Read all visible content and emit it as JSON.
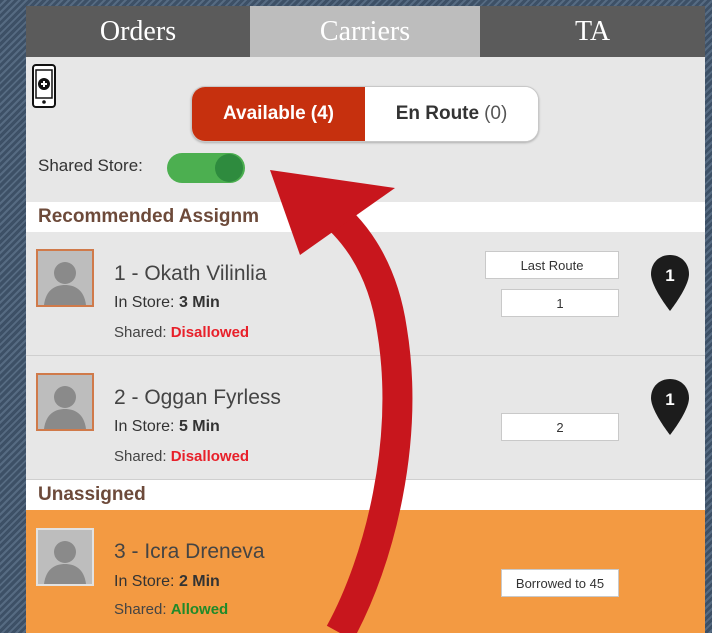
{
  "tabs": [
    {
      "label": "Orders"
    },
    {
      "label": "Carriers"
    },
    {
      "label": "TA"
    }
  ],
  "segment": {
    "available_label": "Available",
    "available_count": "(4)",
    "enroute_label": "En Route",
    "enroute_count": "(0)"
  },
  "shared_store": {
    "label": "Shared Store:",
    "on": true
  },
  "sections": {
    "recommended": "Recommended Assignm",
    "unassigned": "Unassigned"
  },
  "carriers": [
    {
      "name": "1 - Okath Vilinlia",
      "instore_label": "In Store:",
      "instore_value": "3 Min",
      "shared_label": "Shared:",
      "shared_value": "Disallowed",
      "last_route_label": "Last Route",
      "route_value": "1",
      "pin_value": "1"
    },
    {
      "name": "2 - Oggan Fyrless",
      "instore_label": "In Store:",
      "instore_value": "5 Min",
      "shared_label": "Shared:",
      "shared_value": "Disallowed",
      "route_value": "2",
      "pin_value": "1"
    },
    {
      "name": "3 - Icra Dreneva",
      "instore_label": "In Store:",
      "instore_value": "2 Min",
      "shared_label": "Shared:",
      "shared_value": "Allowed",
      "route_value": "Borrowed to 45"
    }
  ],
  "colors": {
    "tab_bg": "#5b5b5b",
    "tab_active_bg": "#bdbdbd",
    "available_bg": "#c6300e",
    "toggle_on": "#4caf50",
    "unassigned_row_bg": "#f39a42",
    "disallowed": "#e8202a",
    "allowed": "#1f8a2a",
    "arrow": "#c8161d"
  }
}
